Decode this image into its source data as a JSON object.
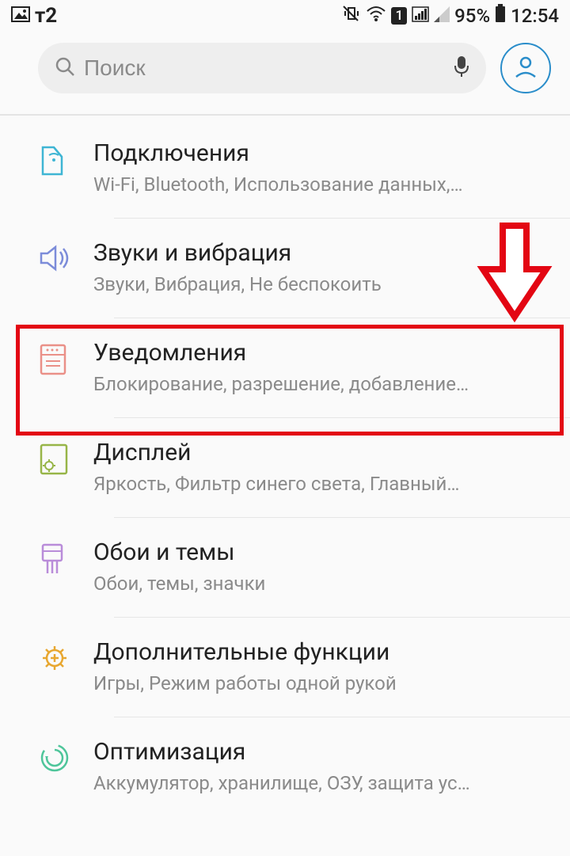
{
  "status": {
    "carrier": "т2",
    "battery": "95%",
    "time": "12:54",
    "simLabel": "1"
  },
  "search": {
    "placeholder": "Поиск"
  },
  "items": [
    {
      "title": "Подключения",
      "subtitle": "Wi-Fi, Bluetooth, Использование данных,…"
    },
    {
      "title": "Звуки и вибрация",
      "subtitle": "Звуки, Вибрация, Не беспокоить"
    },
    {
      "title": "Уведомления",
      "subtitle": "Блокирование, разрешение, добавление…"
    },
    {
      "title": "Дисплей",
      "subtitle": "Яркость, Фильтр синего света, Главный…"
    },
    {
      "title": "Обои и темы",
      "subtitle": "Обои, темы, значки"
    },
    {
      "title": "Дополнительные функции",
      "subtitle": "Игры, Режим работы одной рукой"
    },
    {
      "title": "Оптимизация",
      "subtitle": "Аккумулятор, хранилище, ОЗУ, защита ус…"
    }
  ]
}
